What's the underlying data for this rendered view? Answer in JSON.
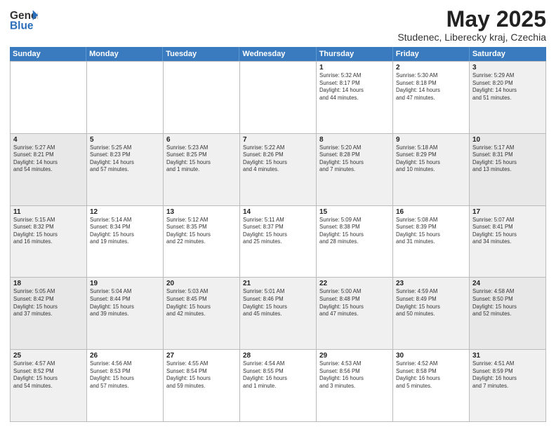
{
  "header": {
    "logo_general": "General",
    "logo_blue": "Blue",
    "title": "May 2025",
    "subtitle": "Studenec, Liberecky kraj, Czechia"
  },
  "calendar": {
    "days_of_week": [
      "Sunday",
      "Monday",
      "Tuesday",
      "Wednesday",
      "Thursday",
      "Friday",
      "Saturday"
    ],
    "weeks": [
      [
        {
          "day": "",
          "info": ""
        },
        {
          "day": "",
          "info": ""
        },
        {
          "day": "",
          "info": ""
        },
        {
          "day": "",
          "info": ""
        },
        {
          "day": "1",
          "info": "Sunrise: 5:32 AM\nSunset: 8:17 PM\nDaylight: 14 hours\nand 44 minutes."
        },
        {
          "day": "2",
          "info": "Sunrise: 5:30 AM\nSunset: 8:18 PM\nDaylight: 14 hours\nand 47 minutes."
        },
        {
          "day": "3",
          "info": "Sunrise: 5:29 AM\nSunset: 8:20 PM\nDaylight: 14 hours\nand 51 minutes."
        }
      ],
      [
        {
          "day": "4",
          "info": "Sunrise: 5:27 AM\nSunset: 8:21 PM\nDaylight: 14 hours\nand 54 minutes."
        },
        {
          "day": "5",
          "info": "Sunrise: 5:25 AM\nSunset: 8:23 PM\nDaylight: 14 hours\nand 57 minutes."
        },
        {
          "day": "6",
          "info": "Sunrise: 5:23 AM\nSunset: 8:25 PM\nDaylight: 15 hours\nand 1 minute."
        },
        {
          "day": "7",
          "info": "Sunrise: 5:22 AM\nSunset: 8:26 PM\nDaylight: 15 hours\nand 4 minutes."
        },
        {
          "day": "8",
          "info": "Sunrise: 5:20 AM\nSunset: 8:28 PM\nDaylight: 15 hours\nand 7 minutes."
        },
        {
          "day": "9",
          "info": "Sunrise: 5:18 AM\nSunset: 8:29 PM\nDaylight: 15 hours\nand 10 minutes."
        },
        {
          "day": "10",
          "info": "Sunrise: 5:17 AM\nSunset: 8:31 PM\nDaylight: 15 hours\nand 13 minutes."
        }
      ],
      [
        {
          "day": "11",
          "info": "Sunrise: 5:15 AM\nSunset: 8:32 PM\nDaylight: 15 hours\nand 16 minutes."
        },
        {
          "day": "12",
          "info": "Sunrise: 5:14 AM\nSunset: 8:34 PM\nDaylight: 15 hours\nand 19 minutes."
        },
        {
          "day": "13",
          "info": "Sunrise: 5:12 AM\nSunset: 8:35 PM\nDaylight: 15 hours\nand 22 minutes."
        },
        {
          "day": "14",
          "info": "Sunrise: 5:11 AM\nSunset: 8:37 PM\nDaylight: 15 hours\nand 25 minutes."
        },
        {
          "day": "15",
          "info": "Sunrise: 5:09 AM\nSunset: 8:38 PM\nDaylight: 15 hours\nand 28 minutes."
        },
        {
          "day": "16",
          "info": "Sunrise: 5:08 AM\nSunset: 8:39 PM\nDaylight: 15 hours\nand 31 minutes."
        },
        {
          "day": "17",
          "info": "Sunrise: 5:07 AM\nSunset: 8:41 PM\nDaylight: 15 hours\nand 34 minutes."
        }
      ],
      [
        {
          "day": "18",
          "info": "Sunrise: 5:05 AM\nSunset: 8:42 PM\nDaylight: 15 hours\nand 37 minutes."
        },
        {
          "day": "19",
          "info": "Sunrise: 5:04 AM\nSunset: 8:44 PM\nDaylight: 15 hours\nand 39 minutes."
        },
        {
          "day": "20",
          "info": "Sunrise: 5:03 AM\nSunset: 8:45 PM\nDaylight: 15 hours\nand 42 minutes."
        },
        {
          "day": "21",
          "info": "Sunrise: 5:01 AM\nSunset: 8:46 PM\nDaylight: 15 hours\nand 45 minutes."
        },
        {
          "day": "22",
          "info": "Sunrise: 5:00 AM\nSunset: 8:48 PM\nDaylight: 15 hours\nand 47 minutes."
        },
        {
          "day": "23",
          "info": "Sunrise: 4:59 AM\nSunset: 8:49 PM\nDaylight: 15 hours\nand 50 minutes."
        },
        {
          "day": "24",
          "info": "Sunrise: 4:58 AM\nSunset: 8:50 PM\nDaylight: 15 hours\nand 52 minutes."
        }
      ],
      [
        {
          "day": "25",
          "info": "Sunrise: 4:57 AM\nSunset: 8:52 PM\nDaylight: 15 hours\nand 54 minutes."
        },
        {
          "day": "26",
          "info": "Sunrise: 4:56 AM\nSunset: 8:53 PM\nDaylight: 15 hours\nand 57 minutes."
        },
        {
          "day": "27",
          "info": "Sunrise: 4:55 AM\nSunset: 8:54 PM\nDaylight: 15 hours\nand 59 minutes."
        },
        {
          "day": "28",
          "info": "Sunrise: 4:54 AM\nSunset: 8:55 PM\nDaylight: 16 hours\nand 1 minute."
        },
        {
          "day": "29",
          "info": "Sunrise: 4:53 AM\nSunset: 8:56 PM\nDaylight: 16 hours\nand 3 minutes."
        },
        {
          "day": "30",
          "info": "Sunrise: 4:52 AM\nSunset: 8:58 PM\nDaylight: 16 hours\nand 5 minutes."
        },
        {
          "day": "31",
          "info": "Sunrise: 4:51 AM\nSunset: 8:59 PM\nDaylight: 16 hours\nand 7 minutes."
        }
      ]
    ]
  }
}
